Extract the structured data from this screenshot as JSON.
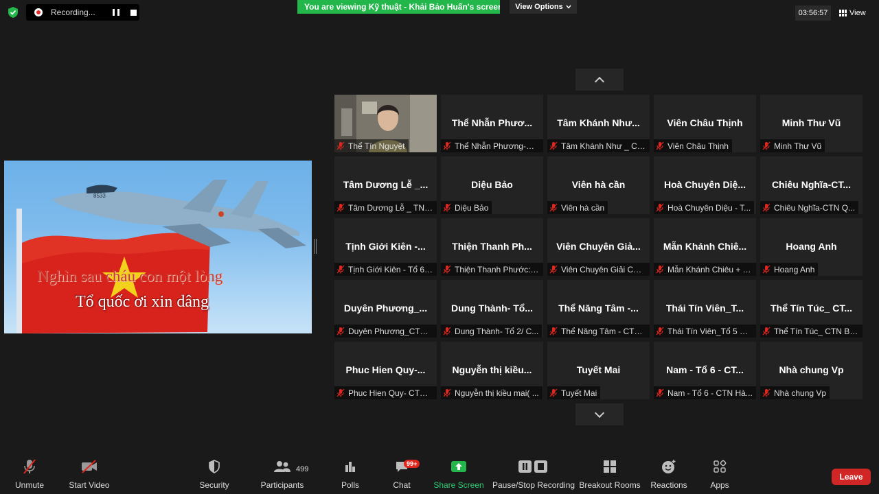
{
  "top": {
    "recording_label": "Recording...",
    "viewing_banner": "You are viewing Kỹ thuật - Khải Bảo Huấn's screen",
    "view_options_label": "View Options",
    "timer": "03:56:57",
    "view_label": "View"
  },
  "shared_screen": {
    "lyric_line_1": "Nghìn sau cháu con một lòng",
    "lyric_line_2": "Tổ quốc ơi xin dâng"
  },
  "gallery": {
    "tiles": [
      {
        "name": "",
        "label": "Thể Tín Nguyệt",
        "video": true
      },
      {
        "name": "Thể Nhẫn Phươ...",
        "label": "Thể Nhẫn Phương-CT..."
      },
      {
        "name": "Tâm Khánh Như...",
        "label": "Tâm Khánh Như _ CT..."
      },
      {
        "name": "Viên Châu Thịnh",
        "label": "Viên Châu Thịnh"
      },
      {
        "name": "Minh Thư Vũ",
        "label": "Minh Thư Vũ"
      },
      {
        "name": "Tâm Dương Lễ _...",
        "label": "Tâm Dương Lễ _ TNBG"
      },
      {
        "name": "Diệu Bảo",
        "label": "Diệu Bảo"
      },
      {
        "name": "Viên hà cần",
        "label": "Viên hà cần"
      },
      {
        "name": "Hoà Chuyên Diệ...",
        "label": "Hoà Chuyên Diệu - T..."
      },
      {
        "name": "Chiêu Nghĩa-CT...",
        "label": "Chiêu Nghĩa-CTN Q..."
      },
      {
        "name": "Tịnh Giới Kiên -...",
        "label": "Tịnh Giới Kiên - Tổ 6 ..."
      },
      {
        "name": "Thiện Thanh Ph...",
        "label": "Thiện Thanh Phước: Đ..."
      },
      {
        "name": "Viên Chuyên Giả...",
        "label": "Viên Chuyên Giải CTN..."
      },
      {
        "name": "Mẫn Khánh Chiê...",
        "label": "Mẫn Khánh Chiêu + T..."
      },
      {
        "name": "Hoang Anh",
        "label": "Hoang Anh"
      },
      {
        "name": "Duyên Phương_...",
        "label": "Duyên Phương_CTN ..."
      },
      {
        "name": "Dung Thành- Tổ...",
        "label": "Dung Thành- Tổ 2/ C..."
      },
      {
        "name": "Thể Năng Tâm -...",
        "label": "Thể Năng Tâm - CTN..."
      },
      {
        "name": "Thái Tín Viên_T...",
        "label": "Thái Tín Viên_Tổ 5 CT..."
      },
      {
        "name": "Thể Tín Túc_ CT...",
        "label": "Thể Tín Túc_ CTN BẮ..."
      },
      {
        "name": "Phuc Hien Quy-...",
        "label": "Phuc Hien Quy- CTN ..."
      },
      {
        "name": "Nguyễn thị kiều...",
        "label": "Nguyễn thị kiều mai( ..."
      },
      {
        "name": "Tuyết Mai",
        "label": "Tuyết Mai"
      },
      {
        "name": "Nam - Tổ 6 - CT...",
        "label": "Nam - Tổ 6 - CTN Hà..."
      },
      {
        "name": "Nhà chung Vp",
        "label": "Nhà chung Vp"
      }
    ]
  },
  "toolbar": {
    "unmute": "Unmute",
    "start_video": "Start Video",
    "security": "Security",
    "participants": "Participants",
    "participants_count": "499",
    "polls": "Polls",
    "chat": "Chat",
    "chat_badge": "99+",
    "share_screen": "Share Screen",
    "pause_stop_recording": "Pause/Stop Recording",
    "breakout_rooms": "Breakout Rooms",
    "reactions": "Reactions",
    "apps": "Apps",
    "leave": "Leave"
  },
  "colors": {
    "background": "#1a1a1a",
    "tile": "#232323",
    "viewing_banner": "#23b64a",
    "share_green": "#23b64a",
    "leave_red": "#d02726",
    "mic_off_red": "#e0261d"
  }
}
